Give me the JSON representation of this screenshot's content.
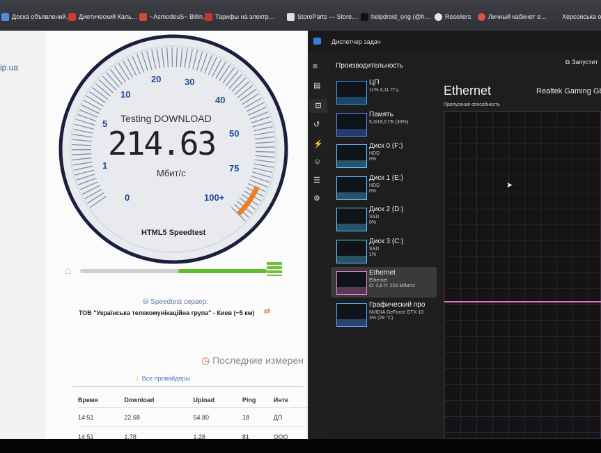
{
  "bookmarks": [
    {
      "label": "Доска объявлений…",
      "icon": "grid-icon",
      "color": "#4f8fd8"
    },
    {
      "label": "Диетический Каль…",
      "icon": "bookmark-red-icon",
      "color": "#d23a2a"
    },
    {
      "label": "~AsmodeuS~ Billin…",
      "icon": "triangle-icon",
      "color": "#d64a3a"
    },
    {
      "label": "Тарифы на электр…",
      "icon": "bookmark-red-icon",
      "color": "#c83232"
    },
    {
      "label": "StoreParts — Store…",
      "icon": "page-icon",
      "color": "#e0e0e0"
    },
    {
      "label": "helpdroid_orig (@h…",
      "icon": "tiktok-icon",
      "color": "#111111"
    },
    {
      "label": "Resellers",
      "icon": "globe-icon",
      "color": "#e6e6e6"
    },
    {
      "label": "Личный кабинет е…",
      "icon": "circle-red-icon",
      "color": "#e05040"
    },
    {
      "label": "Херсонська обл",
      "icon": "none",
      "color": "#000000"
    }
  ],
  "website": {
    "url_fragment": "ip.ua"
  },
  "speedtest": {
    "status": "Testing DOWNLOAD",
    "value": "214.63",
    "unit": "Мбит/с",
    "footer": "HTML5 Speedtest",
    "scale": [
      "0",
      "1",
      "5",
      "10",
      "20",
      "30",
      "40",
      "50",
      "75",
      "100+"
    ],
    "needle_value": 100,
    "server_label": "Speedtest сервер:",
    "server_name": "ТОВ \"Українська телекомунікаційна група\" - Киев (~5 км)",
    "progress": 0.95
  },
  "history": {
    "title": "Последние измерен",
    "link": "Все провайдеры",
    "headers": [
      "Время",
      "Download",
      "Upload",
      "Ping",
      "Инте"
    ],
    "rows": [
      [
        "14:51",
        "22.68",
        "54.80",
        "18",
        "ДП"
      ],
      [
        "14:51",
        "1.78",
        "1.28",
        "81",
        "ООО"
      ]
    ]
  },
  "taskmgr": {
    "title": "Диспетчер задач",
    "section": "Производительность",
    "run_task": "Запустит",
    "items": [
      {
        "name": "ЦП",
        "sub": "11% 4,11 ГГц",
        "selected": false,
        "color": "#3aa0ff"
      },
      {
        "name": "Память",
        "sub": "5,3/16,0 ГБ (33%)",
        "selected": false,
        "color": "#5a7fff"
      },
      {
        "name": "Диск 0 (F:)",
        "sub": "HDD\n0%",
        "selected": false,
        "color": "#5cc7ff"
      },
      {
        "name": "Диск 1 (E:)",
        "sub": "HDD\n0%",
        "selected": false,
        "color": "#5cc7ff"
      },
      {
        "name": "Диск 2 (D:)",
        "sub": "SSD\n0%",
        "selected": false,
        "color": "#5cc7ff"
      },
      {
        "name": "Диск 3 (C:)",
        "sub": "SSD\n1%",
        "selected": false,
        "color": "#5cc7ff"
      },
      {
        "name": "Ethernet",
        "sub": "Ethernet\nО: 2,8 П: 222 Мбит/с",
        "selected": true,
        "color": "#e47fd0"
      },
      {
        "name": "Графический про",
        "sub": "NVIDIA GeForce GTX 10\n3% (29 °C)",
        "selected": false,
        "color": "#5b9bff"
      }
    ],
    "detail_title": "Ethernet",
    "detail_adapter": "Realtek Gaming Gb",
    "detail_label": "Пропускная способность"
  }
}
